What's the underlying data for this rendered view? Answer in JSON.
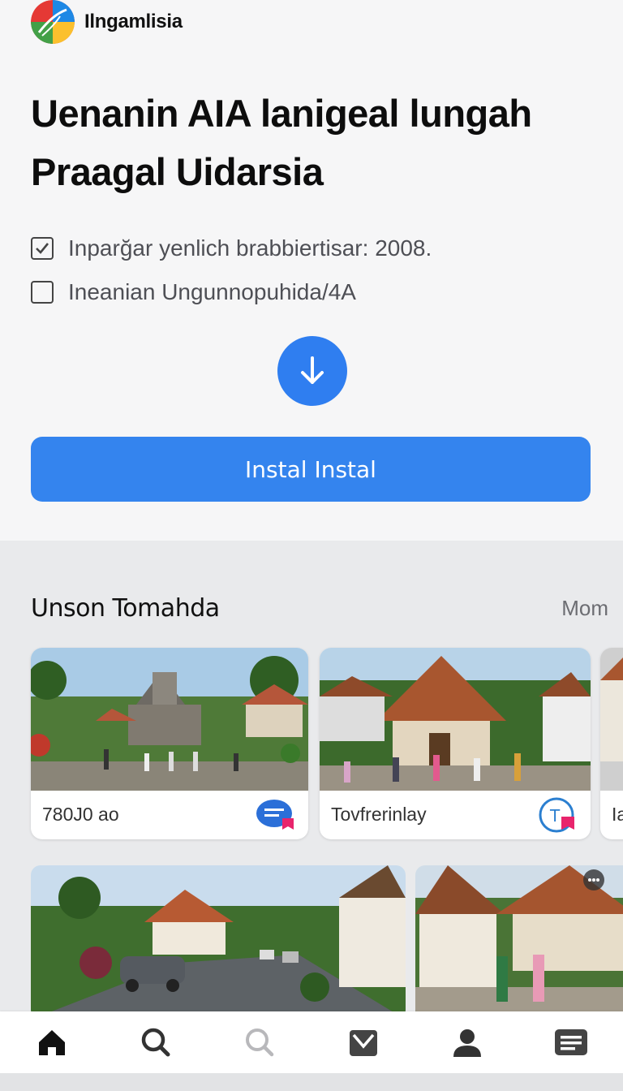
{
  "brand": {
    "name": "Ilngamlisia",
    "logo": "colorful-leaf-logo"
  },
  "headline": {
    "line1": "Uenanin AIA lanigeal lungah",
    "line2": "Praagal Uidarsia"
  },
  "checklist": [
    {
      "label": "Inparğar yenlich brabbiertisar: 2008.",
      "checked": true
    },
    {
      "label": "Ineanian Ungunnopuhida/4A",
      "checked": false
    }
  ],
  "download_icon": "arrow-down-icon",
  "install_button": {
    "label": "Instal Instal"
  },
  "section": {
    "title": "Unson Tomahda",
    "more": "Mom"
  },
  "cards": [
    {
      "caption": "780J0 ao",
      "badge": "chat-badge-icon"
    },
    {
      "caption": "Tovfrerinlay",
      "badge": "text-badge-icon"
    },
    {
      "caption": "Ia"
    }
  ],
  "bottom_nav": [
    {
      "name": "home",
      "icon": "home-icon"
    },
    {
      "name": "search",
      "icon": "search-icon"
    },
    {
      "name": "search-alt",
      "icon": "search-icon"
    },
    {
      "name": "mail",
      "icon": "mail-icon"
    },
    {
      "name": "profile",
      "icon": "person-icon"
    },
    {
      "name": "menu",
      "icon": "list-icon"
    }
  ],
  "colors": {
    "accent": "#3484ee",
    "download": "#2f7ef0",
    "background": "#f6f6f7"
  }
}
